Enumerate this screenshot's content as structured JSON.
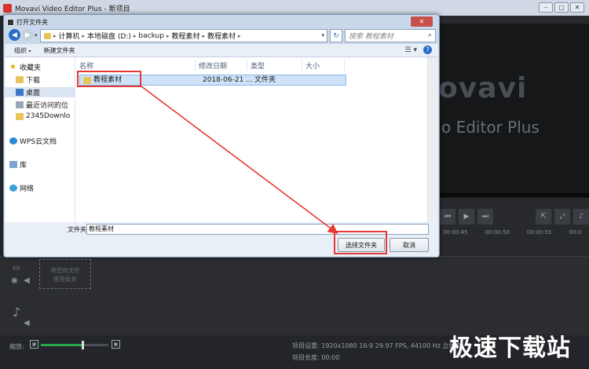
{
  "app": {
    "title": "Movavi Video Editor Plus - 新项目",
    "logo_text": "ovavi",
    "logo_subtitle": "o Editor Plus",
    "ruler_ticks": [
      "00:00:45",
      "00:00:50",
      "00:00:55",
      "00:0"
    ],
    "drop_zone_text": "将您的文件\n拖至此处",
    "zoom_label": "缩放:",
    "zoom_level": 0.62,
    "project_settings": "项目设置:  1920x1080 16:9 29.97 FPS, 44100 Hz 立体声",
    "project_length": "项目长度:  00:00",
    "watermark": "极速下载站"
  },
  "dialog": {
    "title": "打开文件夹",
    "close_label": "✕",
    "address": [
      "计算机",
      "本地磁盘 (D:)",
      "backup",
      "教程素材",
      "教程素材"
    ],
    "search_placeholder": "搜索 教程素材",
    "toolbar": {
      "organize": "组织",
      "new_folder": "新建文件夹"
    },
    "nav": [
      {
        "label": "收藏夹",
        "icon": "star-icon"
      },
      {
        "label": "下载",
        "icon": "folder-icon"
      },
      {
        "label": "桌面",
        "icon": "desktop-icon",
        "selected": true
      },
      {
        "label": "最近访问的位",
        "icon": "recent-icon"
      },
      {
        "label": "2345Downlo",
        "icon": "folder-icon"
      },
      {
        "label": "WPS云文档",
        "icon": "cloud-icon"
      },
      {
        "label": "库",
        "icon": "library-icon"
      },
      {
        "label": "网络",
        "icon": "network-icon"
      }
    ],
    "columns": [
      "名称",
      "修改日期",
      "类型",
      "大小"
    ],
    "files": [
      {
        "name": "教程素材",
        "date": "2018-06-21 ...",
        "type": "文件夹",
        "size": ""
      }
    ],
    "filename_label": "文件夹:",
    "filename_value": "教程素材",
    "select_button": "选择文件夹",
    "cancel_button": "取消"
  },
  "colors": {
    "highlight": "#e53935",
    "accent": "#2a6cc7"
  }
}
